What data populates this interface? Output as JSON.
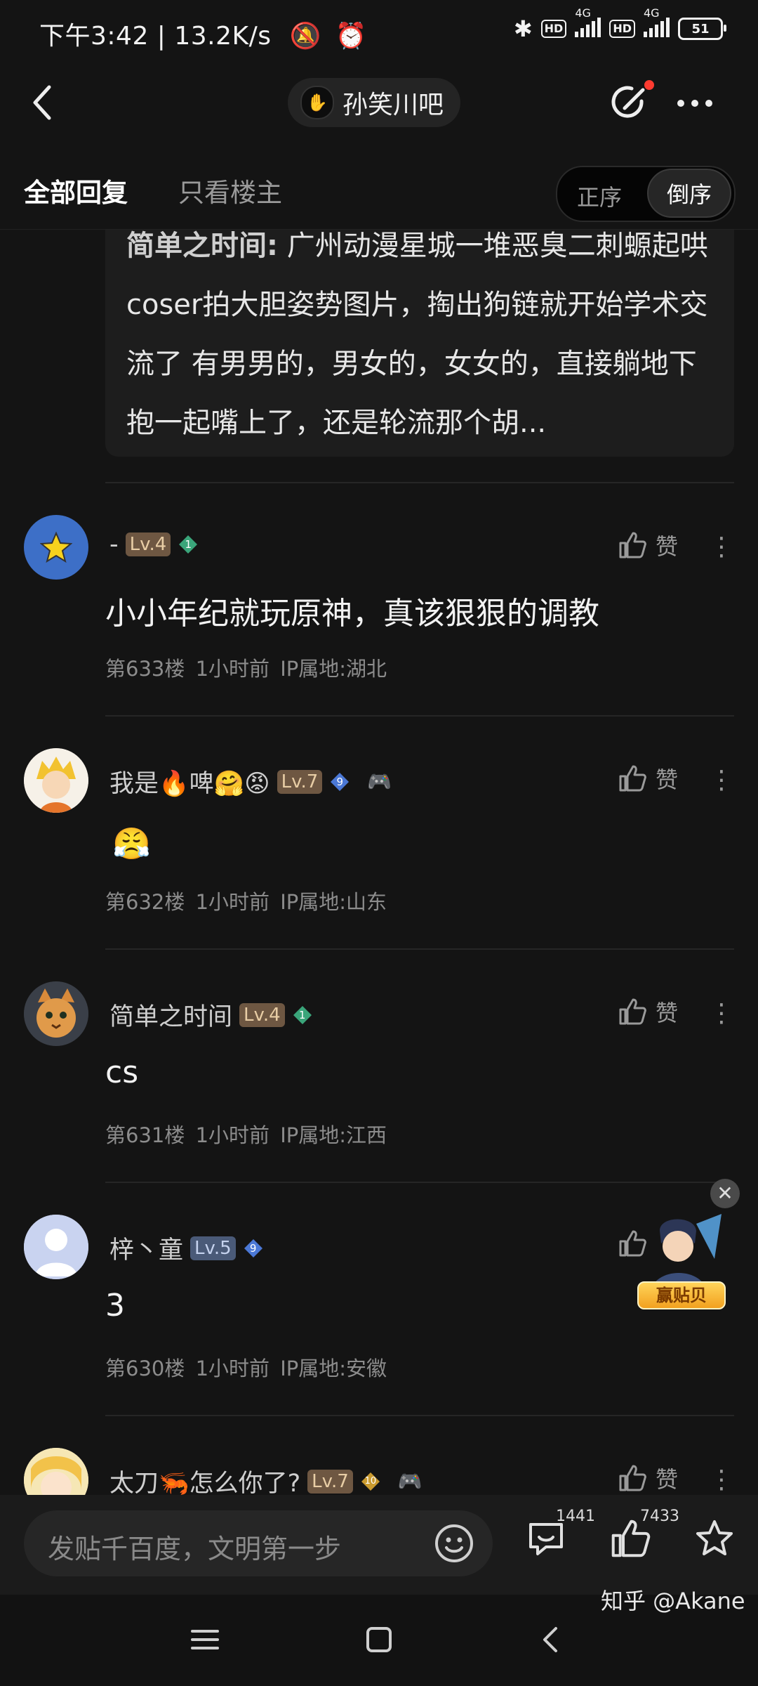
{
  "status_bar": {
    "time_speed": "下午3:42 | 13.2K/s",
    "hd1": "HD",
    "net1": "4G",
    "hd2": "HD",
    "net2": "4G",
    "battery": "51"
  },
  "nav": {
    "forum_name": "孙笑川吧"
  },
  "filter": {
    "tab_all": "全部回复",
    "tab_op": "只看楼主",
    "sort_asc": "正序",
    "sort_desc": "倒序"
  },
  "quote": {
    "author": "简单之时间:",
    "text": " 广州动漫星城一堆恶臭二刺螈起哄coser拍大胆姿势图片，掏出狗链就开始学术交流了 有男男的，男女的，女女的，直接躺地下抱一起嘴上了，还是轮流那个胡..."
  },
  "like_label": "赞",
  "comments": [
    {
      "username": "-",
      "level": "Lv.4",
      "gem": "1",
      "text": "小小年纪就玩原神，真该狠狠的调教",
      "floor": "第633楼",
      "time": "1小时前",
      "ip": "IP属地:湖北"
    },
    {
      "username": "我是🔥啤🤗😡",
      "level": "Lv.7",
      "gem": "9",
      "extra_icon": "🎮",
      "text": "😤",
      "floor": "第632楼",
      "time": "1小时前",
      "ip": "IP属地:山东"
    },
    {
      "username": "简单之时间",
      "level": "Lv.4",
      "gem": "1",
      "text": "cs",
      "floor": "第631楼",
      "time": "1小时前",
      "ip": "IP属地:江西"
    },
    {
      "username": "梓丶童",
      "level": "Lv.5",
      "gem": "9",
      "text": "3",
      "floor": "第630楼",
      "time": "1小时前",
      "ip": "IP属地:安徽"
    },
    {
      "username": "太刀🦐怎么你了?",
      "level": "Lv.7",
      "gem": "10",
      "extra_icon": "🎮"
    }
  ],
  "float_badge": {
    "label": "赢贴贝"
  },
  "input_bar": {
    "placeholder": "发贴千百度，文明第一步",
    "comment_count": "1441",
    "like_count": "7433"
  },
  "watermark": "知乎 @Akane",
  "colors": {
    "background": "#141414",
    "accent_red": "#ff3b30",
    "level_gold": "#6e5742",
    "level_blue": "#4a5a78",
    "gem_green": "#3aa57a",
    "gem_blue": "#4b78d6",
    "gem_gold": "#c99a2e"
  }
}
